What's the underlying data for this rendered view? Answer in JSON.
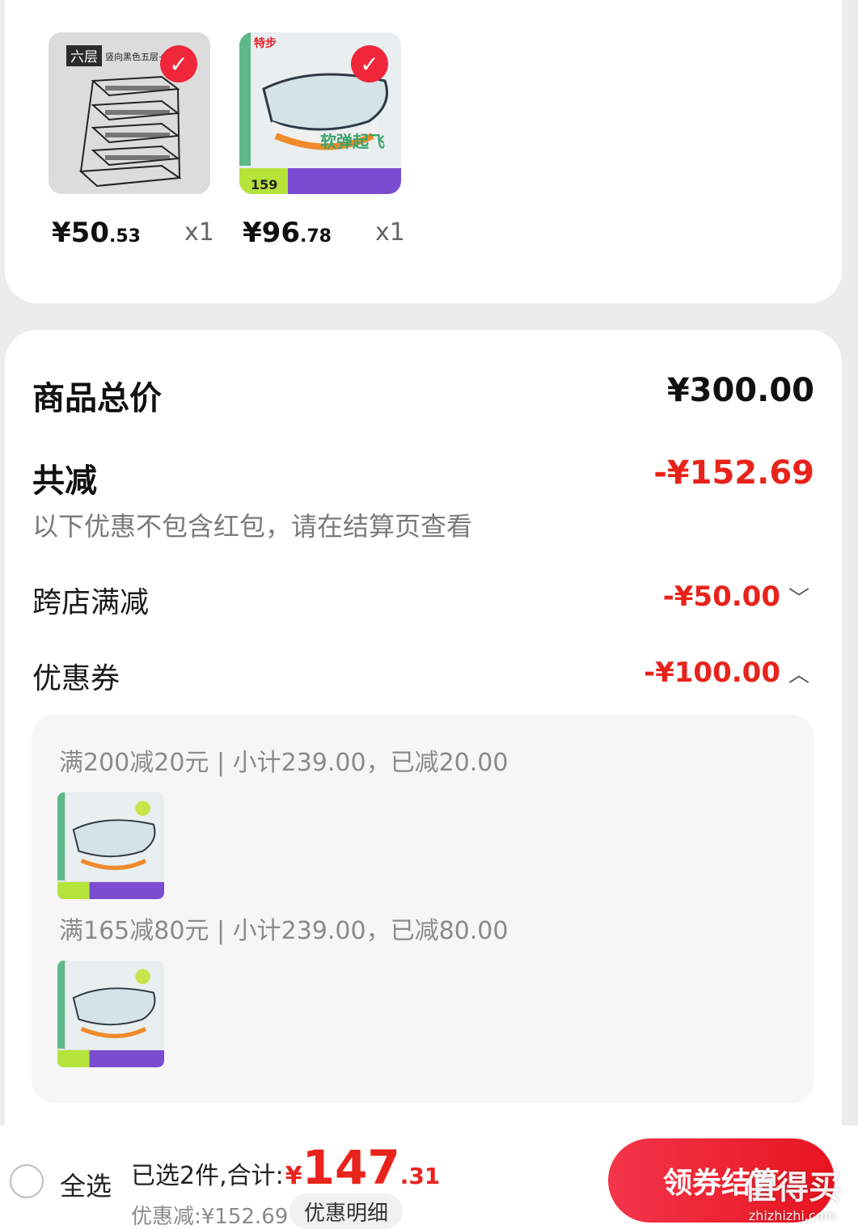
{
  "products": [
    {
      "thumb_badge": "六层",
      "thumb_caption": "竖向黑色五层+顶",
      "price_symbol": "¥",
      "price_int": "50",
      "price_dec": ".53",
      "quantity": "x1",
      "selected": true
    },
    {
      "thumb_brand": "特步",
      "thumb_slogan": "软弹起飞",
      "thumb_price": "159",
      "price_symbol": "¥",
      "price_int": "96",
      "price_dec": ".78",
      "quantity": "x1",
      "selected": true
    }
  ],
  "summary": {
    "total_label": "商品总价",
    "total_value": "¥300.00",
    "reduce_label": "共减",
    "reduce_value": "-¥152.69",
    "note": "以下优惠不包含红包，请在结算页查看",
    "cross_store_label": "跨店满减",
    "cross_store_value": "-¥50.00",
    "coupon_label": "优惠券",
    "coupon_value": "-¥100.00"
  },
  "coupon_details": [
    {
      "text": "满200减20元 | 小计239.00，已减20.00"
    },
    {
      "text": "满165减80元 | 小计239.00，已减80.00"
    }
  ],
  "bottom_bar": {
    "select_all": "全选",
    "selected_text": "已选2件,合计:",
    "currency": "¥",
    "total_int": "147",
    "total_dec": ".31",
    "discount_text": "优惠减:¥152.69",
    "detail_button": "优惠明细",
    "checkout_button": "领券结算"
  },
  "watermark": {
    "main": "值得买",
    "url": "zhizhizhi.com"
  },
  "colors": {
    "accent_red": "#e8231b",
    "checkout_red": "#f0263b"
  }
}
